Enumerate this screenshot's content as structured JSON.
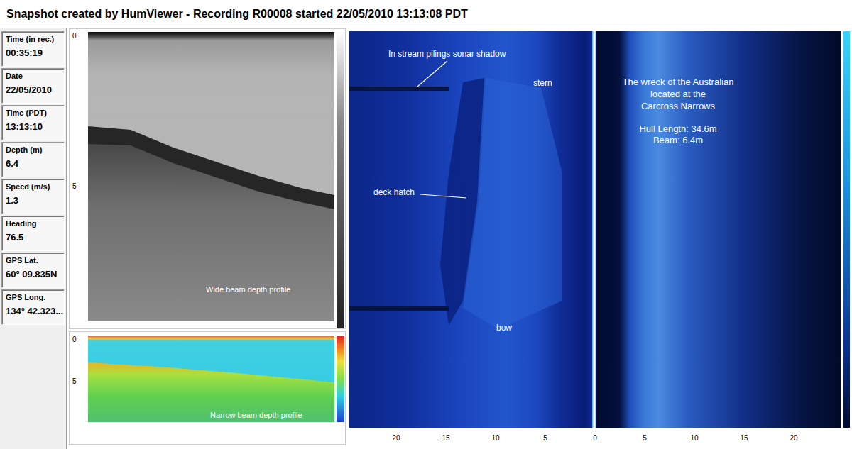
{
  "window": {
    "title": "Snapshot created by HumViewer - Recording R00008 started 22/05/2010 13:13:08 PDT"
  },
  "readouts": [
    {
      "label": "Time (in rec.)",
      "value": "00:35:19"
    },
    {
      "label": "Date",
      "value": "22/05/2010"
    },
    {
      "label": "Time (PDT)",
      "value": "13:13:10"
    },
    {
      "label": "Depth (m)",
      "value": "6.4"
    },
    {
      "label": "Speed (m/s)",
      "value": "1.3"
    },
    {
      "label": "Heading",
      "value": "76.5"
    },
    {
      "label": "GPS Lat.",
      "value": "60° 09.835N"
    },
    {
      "label": "GPS Long.",
      "value": "134° 42.323..."
    }
  ],
  "wide_beam": {
    "label": "Wide beam depth profile",
    "ticks": [
      "0",
      "5"
    ]
  },
  "narrow_beam": {
    "label": "Narrow beam depth profile",
    "ticks": [
      "0",
      "5"
    ]
  },
  "side_scan": {
    "annotations": [
      {
        "lines": [
          "In stream pilings sonar shadow"
        ]
      },
      {
        "lines": [
          "stern"
        ]
      },
      {
        "lines": [
          "deck hatch"
        ]
      },
      {
        "lines": [
          "bow"
        ]
      },
      {
        "lines": [
          "The wreck of the Australian",
          "located at the",
          "Carcross Narrows"
        ]
      },
      {
        "lines": [
          "Hull Length: 34.6m",
          "Beam: 6.4m"
        ]
      }
    ],
    "x_ticks": [
      "20",
      "15",
      "10",
      "5",
      "0",
      "5",
      "10",
      "15",
      "20"
    ]
  }
}
